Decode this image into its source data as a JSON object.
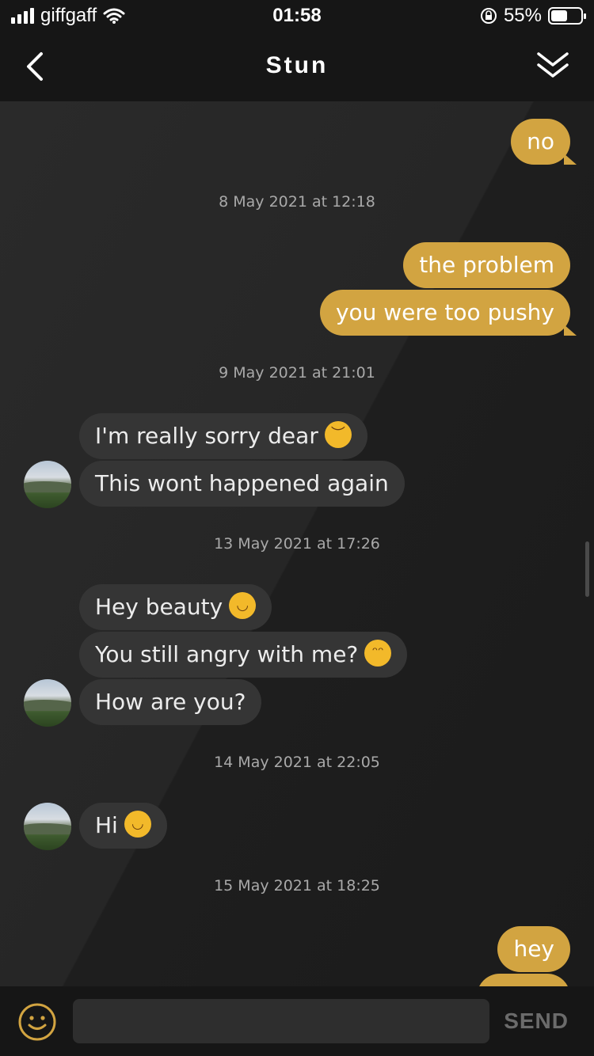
{
  "status_bar": {
    "carrier": "giffgaff",
    "time": "01:58",
    "battery": "55%",
    "icons": [
      "signal-icon",
      "wifi-icon",
      "rotation-lock-icon",
      "battery-icon"
    ]
  },
  "header": {
    "title": "Stun",
    "back_icon": "chevron-left-icon",
    "collapse_icon": "double-chevron-down-icon"
  },
  "messages": [
    {
      "dir": "out",
      "text": "no"
    },
    {
      "timestamp": "8 May 2021 at 12:18"
    },
    {
      "dir": "out",
      "text": "the problem"
    },
    {
      "dir": "out",
      "text": "you were too pushy"
    },
    {
      "timestamp": "9 May 2021 at 21:01"
    },
    {
      "dir": "in",
      "text": "I'm really sorry dear",
      "emoji": "pensive-face"
    },
    {
      "dir": "in",
      "text": "This wont happened again"
    },
    {
      "timestamp": "13 May 2021 at 17:26"
    },
    {
      "dir": "in",
      "text": "Hey beauty",
      "emoji": "smiling-face"
    },
    {
      "dir": "in",
      "text": "You still angry with me?",
      "emoji": "pleading-face"
    },
    {
      "dir": "in",
      "text": "How are you?"
    },
    {
      "timestamp": "14 May 2021 at 22:05"
    },
    {
      "dir": "in",
      "text": "Hi",
      "emoji": "smiling-face"
    },
    {
      "timestamp": "15 May 2021 at 18:25"
    },
    {
      "dir": "out",
      "text": "hey"
    }
  ],
  "composer": {
    "emoji_icon": "smiley-icon",
    "input_value": "",
    "send_label": "SEND"
  },
  "colors": {
    "outgoing_bubble": "#d2a441",
    "incoming_bubble": "#353535",
    "background": "#1c1c1c"
  }
}
